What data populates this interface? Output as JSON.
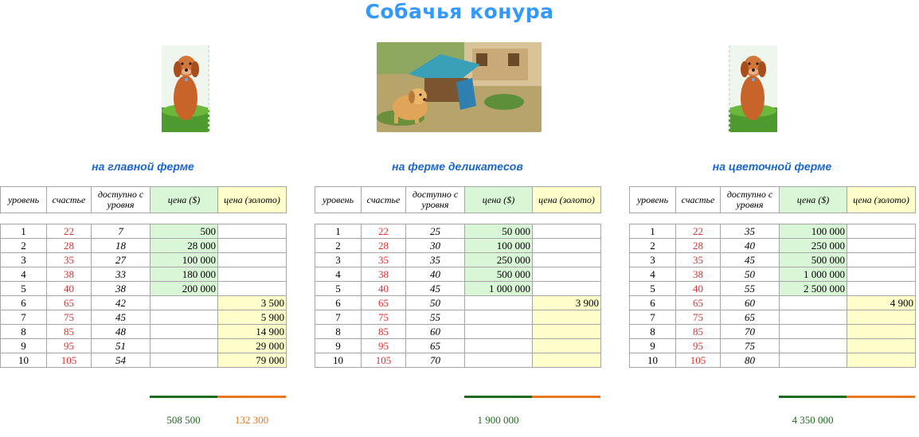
{
  "page_title": "Собачья конура",
  "colors": {
    "title": "#3399ff",
    "farm_title": "#1a66cc",
    "happiness": "#e03030",
    "cash_fill": "#d9f7d6",
    "gold_fill": "#ffffcc",
    "cash_total": "#1e6b1e",
    "gold_total": "#e87722"
  },
  "headers": {
    "level": "уровень",
    "happiness": "счастье",
    "available": "доступно с уровня",
    "price_cash": "цена ($)",
    "price_gold": "цена (золото)"
  },
  "farms": [
    {
      "title": "на главной ферме",
      "rows": [
        {
          "level": "1",
          "happiness": "22",
          "available": "7",
          "cash": "500",
          "gold": ""
        },
        {
          "level": "2",
          "happiness": "28",
          "available": "18",
          "cash": "28 000",
          "gold": ""
        },
        {
          "level": "3",
          "happiness": "35",
          "available": "27",
          "cash": "100 000",
          "gold": ""
        },
        {
          "level": "4",
          "happiness": "38",
          "available": "33",
          "cash": "180 000",
          "gold": ""
        },
        {
          "level": "5",
          "happiness": "40",
          "available": "38",
          "cash": "200 000",
          "gold": ""
        },
        {
          "level": "6",
          "happiness": "65",
          "available": "42",
          "cash": "",
          "gold": "3 500"
        },
        {
          "level": "7",
          "happiness": "75",
          "available": "45",
          "cash": "",
          "gold": "5 900"
        },
        {
          "level": "8",
          "happiness": "85",
          "available": "48",
          "cash": "",
          "gold": "14 900"
        },
        {
          "level": "9",
          "happiness": "95",
          "available": "51",
          "cash": "",
          "gold": "29 000"
        },
        {
          "level": "10",
          "happiness": "105",
          "available": "54",
          "cash": "",
          "gold": "79 000"
        }
      ],
      "total_cash": "508 500",
      "total_gold": "132 300"
    },
    {
      "title": "на ферме деликатесов",
      "rows": [
        {
          "level": "1",
          "happiness": "22",
          "available": "25",
          "cash": "50 000",
          "gold": ""
        },
        {
          "level": "2",
          "happiness": "28",
          "available": "30",
          "cash": "100 000",
          "gold": ""
        },
        {
          "level": "3",
          "happiness": "35",
          "available": "35",
          "cash": "250 000",
          "gold": ""
        },
        {
          "level": "4",
          "happiness": "38",
          "available": "40",
          "cash": "500 000",
          "gold": ""
        },
        {
          "level": "5",
          "happiness": "40",
          "available": "45",
          "cash": "1 000 000",
          "gold": ""
        },
        {
          "level": "6",
          "happiness": "65",
          "available": "50",
          "cash": "",
          "gold": "3 900"
        },
        {
          "level": "7",
          "happiness": "75",
          "available": "55",
          "cash": "",
          "gold": ""
        },
        {
          "level": "8",
          "happiness": "85",
          "available": "60",
          "cash": "",
          "gold": ""
        },
        {
          "level": "9",
          "happiness": "95",
          "available": "65",
          "cash": "",
          "gold": ""
        },
        {
          "level": "10",
          "happiness": "105",
          "available": "70",
          "cash": "",
          "gold": ""
        }
      ],
      "total_cash": "1 900 000",
      "total_gold": ""
    },
    {
      "title": "на цветочной ферме",
      "rows": [
        {
          "level": "1",
          "happiness": "22",
          "available": "35",
          "cash": "100 000",
          "gold": ""
        },
        {
          "level": "2",
          "happiness": "28",
          "available": "40",
          "cash": "250 000",
          "gold": ""
        },
        {
          "level": "3",
          "happiness": "35",
          "available": "45",
          "cash": "500 000",
          "gold": ""
        },
        {
          "level": "4",
          "happiness": "38",
          "available": "50",
          "cash": "1 000 000",
          "gold": ""
        },
        {
          "level": "5",
          "happiness": "40",
          "available": "55",
          "cash": "2 500 000",
          "gold": ""
        },
        {
          "level": "6",
          "happiness": "65",
          "available": "60",
          "cash": "",
          "gold": "4 900"
        },
        {
          "level": "7",
          "happiness": "75",
          "available": "65",
          "cash": "",
          "gold": ""
        },
        {
          "level": "8",
          "happiness": "85",
          "available": "70",
          "cash": "",
          "gold": ""
        },
        {
          "level": "9",
          "happiness": "95",
          "available": "75",
          "cash": "",
          "gold": ""
        },
        {
          "level": "10",
          "happiness": "105",
          "available": "80",
          "cash": "",
          "gold": ""
        }
      ],
      "total_cash": "4 350 000",
      "total_gold": ""
    }
  ]
}
